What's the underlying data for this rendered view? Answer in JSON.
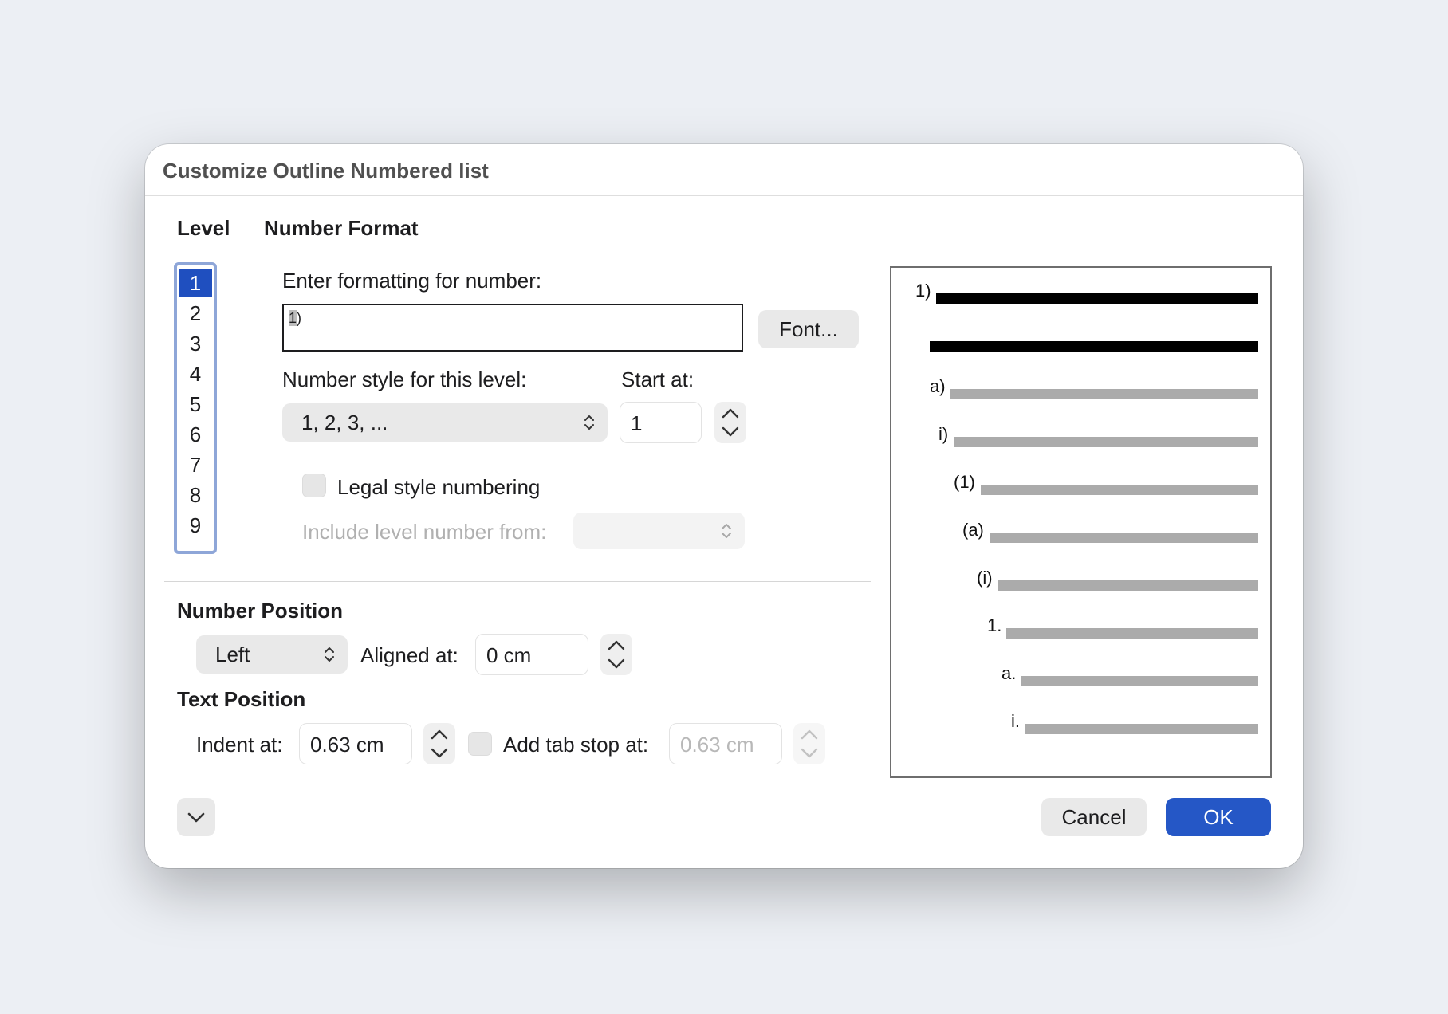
{
  "dialog": {
    "title": "Customize Outline Numbered list"
  },
  "level": {
    "heading": "Level",
    "items": [
      "1",
      "2",
      "3",
      "4",
      "5",
      "6",
      "7",
      "8",
      "9"
    ],
    "selected": "1"
  },
  "number_format": {
    "heading": "Number Format",
    "enter_label": "Enter formatting for number:",
    "format_highlight": "1",
    "format_rest": ")",
    "font_button": "Font...",
    "style_label": "Number style for this level:",
    "style_value": "1, 2, 3, ...",
    "start_label": "Start at:",
    "start_value": "1",
    "legal_label": "Legal style numbering",
    "include_label": "Include level number from:",
    "include_value": ""
  },
  "number_position": {
    "heading": "Number Position",
    "alignment_value": "Left",
    "aligned_label": "Aligned at:",
    "aligned_value": "0 cm"
  },
  "text_position": {
    "heading": "Text Position",
    "indent_label": "Indent at:",
    "indent_value": "0.63 cm",
    "tab_label": "Add tab stop at:",
    "tab_value": "0.63 cm"
  },
  "buttons": {
    "cancel": "Cancel",
    "ok": "OK"
  },
  "preview": {
    "labels": [
      "1)",
      "a)",
      "i)",
      "(1)",
      "(a)",
      "(i)",
      "1.",
      "a.",
      "i."
    ]
  },
  "colors": {
    "accent": "#2557c6",
    "selection": "#1f4fbf",
    "list_border": "#8ea6d8"
  }
}
